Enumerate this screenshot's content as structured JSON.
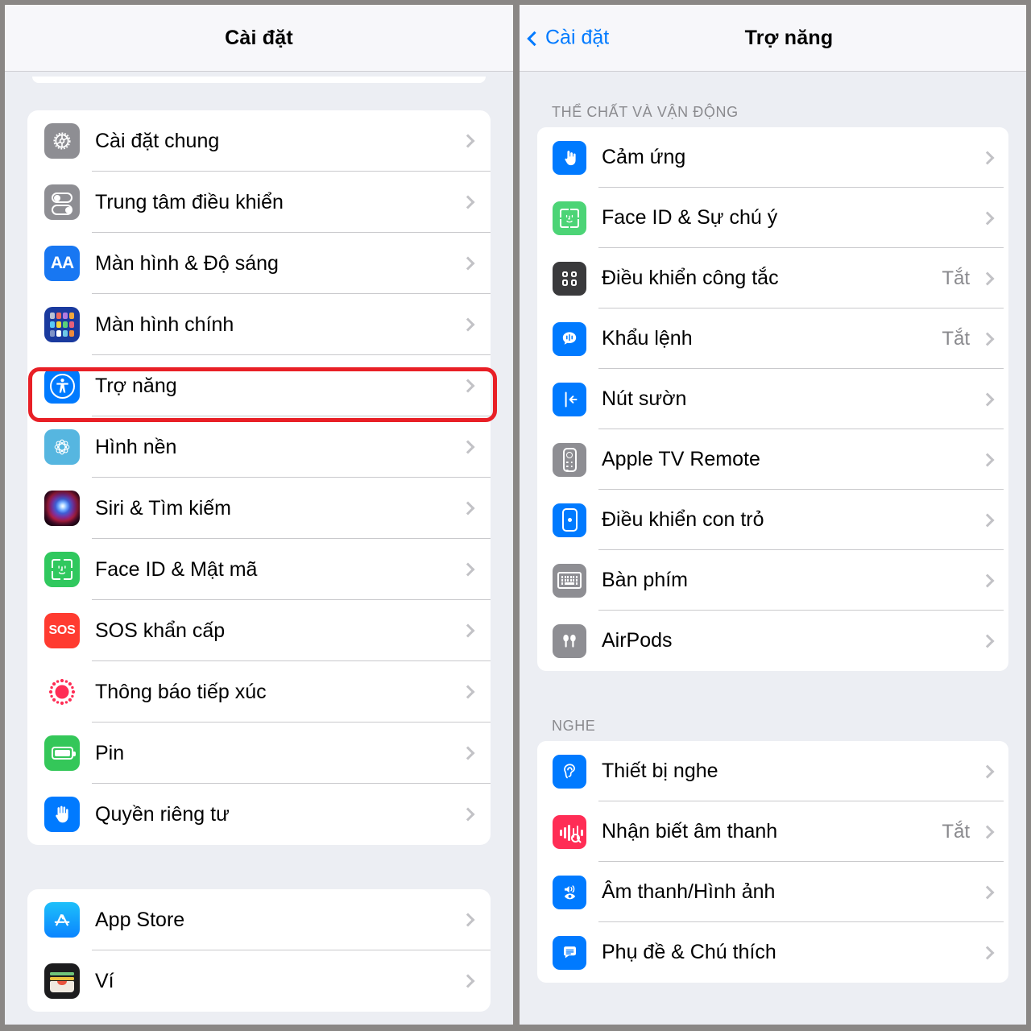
{
  "left": {
    "nav": {
      "title": "Cài đặt"
    },
    "groups": [
      {
        "rows": [
          {
            "label": "Cài đặt chung",
            "icon": "gear-icon"
          },
          {
            "label": "Trung tâm điều khiển",
            "icon": "control-center-icon"
          },
          {
            "label": "Màn hình & Độ sáng",
            "icon": "display-brightness-icon"
          },
          {
            "label": "Màn hình chính",
            "icon": "home-screen-icon"
          },
          {
            "label": "Trợ năng",
            "icon": "accessibility-icon",
            "highlighted": true
          },
          {
            "label": "Hình nền",
            "icon": "wallpaper-icon"
          },
          {
            "label": "Siri & Tìm kiếm",
            "icon": "siri-icon"
          },
          {
            "label": "Face ID & Mật mã",
            "icon": "face-id-icon"
          },
          {
            "label": "SOS khẩn cấp",
            "icon": "sos-icon"
          },
          {
            "label": "Thông báo tiếp xúc",
            "icon": "exposure-notification-icon"
          },
          {
            "label": "Pin",
            "icon": "battery-icon"
          },
          {
            "label": "Quyền riêng tư",
            "icon": "privacy-hand-icon"
          }
        ]
      },
      {
        "rows": [
          {
            "label": "App Store",
            "icon": "app-store-icon"
          },
          {
            "label": "Ví",
            "icon": "wallet-icon"
          }
        ]
      }
    ]
  },
  "right": {
    "nav": {
      "back_label": "Cài đặt",
      "title": "Trợ năng"
    },
    "sections": [
      {
        "header": "THỂ CHẤT VÀ VẬN ĐỘNG",
        "rows": [
          {
            "label": "Cảm ứng",
            "icon": "touch-icon",
            "value": "",
            "highlighted": true
          },
          {
            "label": "Face ID & Sự chú ý",
            "icon": "face-id-icon",
            "value": ""
          },
          {
            "label": "Điều khiển công tắc",
            "icon": "switch-control-icon",
            "value": "Tắt"
          },
          {
            "label": "Khẩu lệnh",
            "icon": "voice-control-icon",
            "value": "Tắt"
          },
          {
            "label": "Nút sườn",
            "icon": "side-button-icon",
            "value": ""
          },
          {
            "label": "Apple TV Remote",
            "icon": "apple-tv-remote-icon",
            "value": ""
          },
          {
            "label": "Điều khiển con trỏ",
            "icon": "pointer-control-icon",
            "value": ""
          },
          {
            "label": "Bàn phím",
            "icon": "keyboard-icon",
            "value": ""
          },
          {
            "label": "AirPods",
            "icon": "airpods-icon",
            "value": ""
          }
        ]
      },
      {
        "header": "NGHE",
        "rows": [
          {
            "label": "Thiết bị nghe",
            "icon": "hearing-device-icon",
            "value": ""
          },
          {
            "label": "Nhận biết âm thanh",
            "icon": "sound-recognition-icon",
            "value": "Tắt"
          },
          {
            "label": "Âm thanh/Hình ảnh",
            "icon": "audio-visual-icon",
            "value": ""
          },
          {
            "label": "Phụ đề & Chú thích",
            "icon": "subtitles-icon",
            "value": ""
          }
        ]
      }
    ]
  },
  "colors": {
    "accent_blue": "#007aff",
    "highlight_red": "#e81f26",
    "background": "#eceef3",
    "card": "#ffffff",
    "secondary_text": "#8a8a8e"
  }
}
